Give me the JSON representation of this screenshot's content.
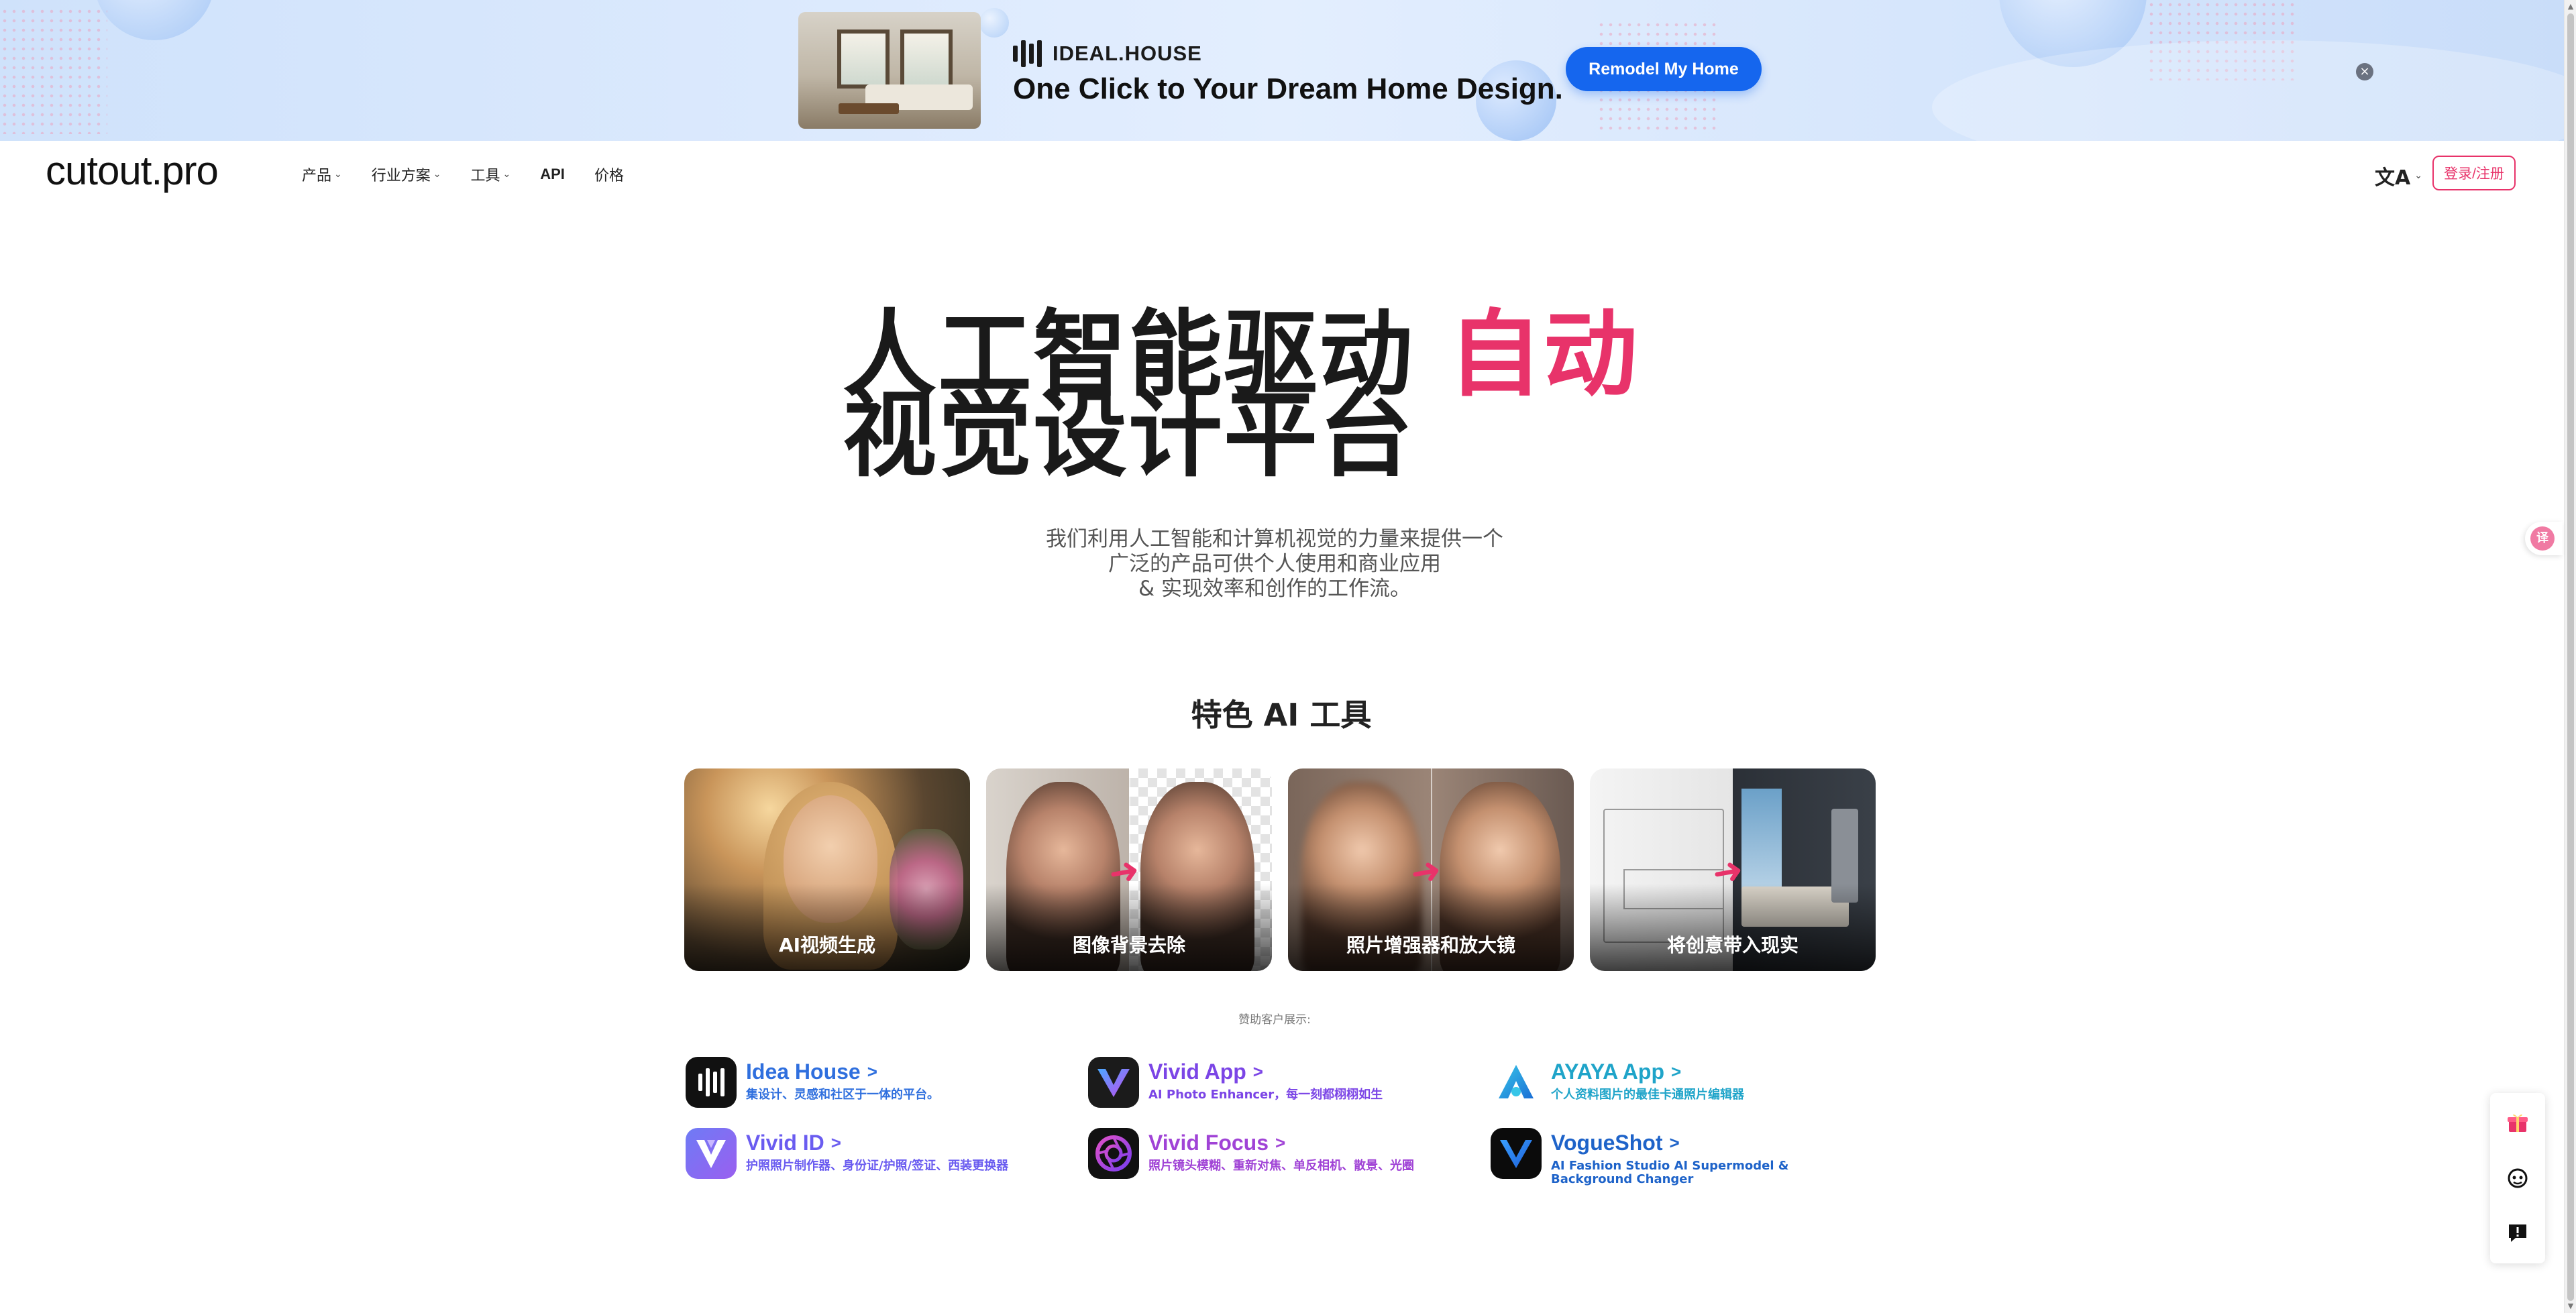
{
  "banner": {
    "brand": "IDEAL.HOUSE",
    "headline": "One Click to Your Dream Home Design.",
    "cta_label": "Remodel My Home",
    "close_glyph": "×"
  },
  "nav": {
    "logo": "cutout.pro",
    "items": [
      {
        "label": "产品",
        "chevron": "⌄"
      },
      {
        "label": "行业方案",
        "chevron": "⌄"
      },
      {
        "label": "工具",
        "chevron": "⌄"
      },
      {
        "label": "API"
      },
      {
        "label": "价格"
      }
    ],
    "lang_glyph": "文A",
    "lang_chevron": "⌄",
    "login_label": "登录/注册"
  },
  "hero": {
    "title_part1": "人工智能驱动 ",
    "title_accent": "自动",
    "title_line2": "视觉设计平台",
    "desc_line1": "我们利用人工智能和计算机视觉的力量来提供一个",
    "desc_line2": "广泛的产品可供个人使用和商业应用",
    "desc_line3": "& 实现效率和创作的工作流。"
  },
  "featured": {
    "title": "特色 AI 工具",
    "cards": [
      {
        "label": "AI视频生成"
      },
      {
        "label": "图像背景去除"
      },
      {
        "label": "照片增强器和放大镜"
      },
      {
        "label": "将创意带入现实"
      }
    ]
  },
  "sponsors": {
    "caption": "赞助客户展示:",
    "items": [
      {
        "name": "Idea House",
        "desc": "集设计、灵感和社区于一体的平台。",
        "color": "#2f6fde"
      },
      {
        "name": "Vivid App",
        "desc": "AI Photo Enhancer，每一刻都栩栩如生",
        "color": "#7b45e6"
      },
      {
        "name": "AYAYA App",
        "desc": "个人资料图片的最佳卡通照片编辑器",
        "color": "#1fa4c9"
      },
      {
        "name": "Vivid ID",
        "desc": "护照照片制作器、身份证/护照/签证、西装更换器",
        "color": "#6a5cf0"
      },
      {
        "name": "Vivid Focus",
        "desc": "照片镜头模糊、重新对焦、单反相机、散景、光圈",
        "color": "#a043d6"
      },
      {
        "name": "VogueShot",
        "desc": "AI Fashion Studio AI Supermodel & Background Changer",
        "color": "#1e63c9"
      }
    ],
    "chevron": ">"
  },
  "side": {
    "translate_glyph": "译"
  },
  "colors": {
    "accent": "#e8336a",
    "promo_blue": "#1566ee"
  }
}
